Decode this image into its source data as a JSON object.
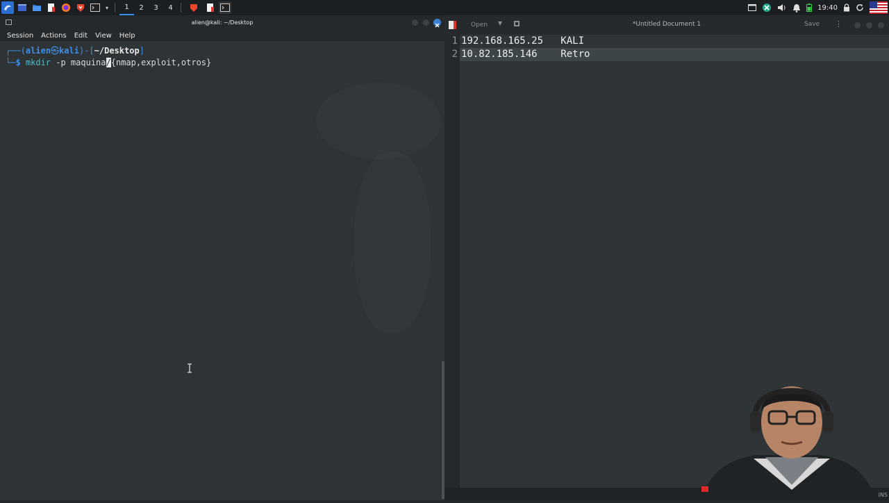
{
  "taskbar": {
    "workspaces": [
      "1",
      "2",
      "3",
      "4"
    ],
    "active_workspace": "1",
    "clock": "19:40",
    "icons": [
      "kali-menu-icon",
      "show-desktop-icon",
      "file-manager-icon",
      "text-editor-icon",
      "firefox-icon",
      "burp-icon",
      "terminal-icon"
    ]
  },
  "terminal": {
    "title": "alien@kali: ~/Desktop",
    "menu": [
      "Session",
      "Actions",
      "Edit",
      "View",
      "Help"
    ],
    "prompt": {
      "corner": "┌──",
      "user_host_open": "(",
      "user": "alien",
      "at": "㉿",
      "host": "kali",
      "user_host_close": ")-[",
      "path": "~/Desktop",
      "path_close": "]",
      "second_line": "└─",
      "dollar": "$ "
    },
    "command": {
      "cmd": "mkdir",
      "args_before_cursor": " -p maquina",
      "cursor_char": "/",
      "args_after_cursor": "{nmap,exploit,otros}"
    }
  },
  "editor": {
    "open_label": "Open",
    "title": "*Untitled Document 1",
    "save_label": "Save",
    "status_mode": "INS",
    "lines": [
      {
        "num": "1",
        "text": "192.168.165.25   KALI"
      },
      {
        "num": "2",
        "text": "10.82.185.146    Retro"
      }
    ],
    "current_line": 2
  },
  "colors": {
    "terminal_bg": "#2e3436",
    "prompt_blue": "#3c8ee8",
    "command_cyan": "#56b6c2",
    "editor_bg": "#2f3537"
  }
}
